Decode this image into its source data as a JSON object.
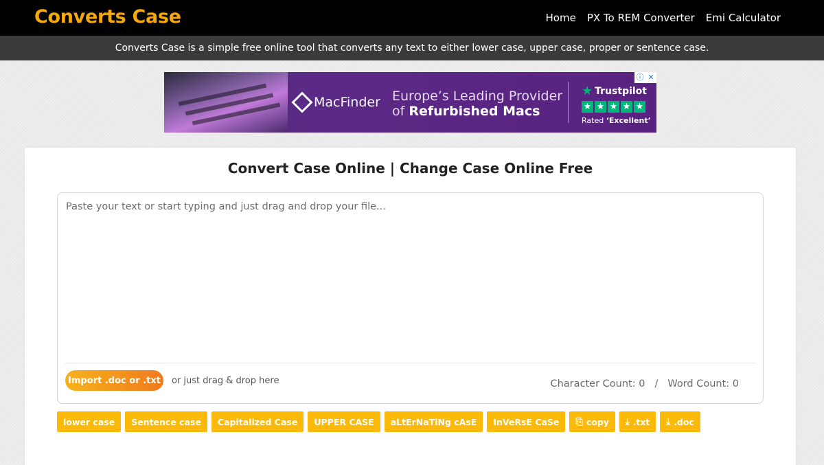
{
  "header": {
    "brand": "Converts Case",
    "nav": [
      "Home",
      "PX To REM Converter",
      "Emi Calculator"
    ]
  },
  "tagline": "Converts Case is a simple free online tool that converts any text to either lower case, upper case, proper or sentence case.",
  "ad": {
    "logo_text": "MacFinder",
    "headline_line1": "Europe’s Leading Provider",
    "headline_prefix": "of",
    "headline_bold": "Refurbished Macs",
    "trustpilot_label": "Trustpilot",
    "rated_prefix": "Rated",
    "rated_value": "‘Excellent’"
  },
  "main": {
    "title": "Convert Case Online | Change Case Online Free",
    "editor_placeholder": "Paste your text or start typing and just drag and drop your file...",
    "import_label": "Import .doc or .txt",
    "drag_hint": "or just drag & drop here",
    "char_count_label": "Character Count: 0",
    "count_separator": "/",
    "word_count_label": "Word Count: 0"
  },
  "toolbar": {
    "lower": "lower case",
    "sentence": "Sentence case",
    "capitalized": "Capitalized Case",
    "upper": "UPPER CASE",
    "alternating": "aLtErNaTiNg cAsE",
    "inverse": "InVeRsE CaSe",
    "copy": "copy",
    "txt": ".txt",
    "doc": ".doc"
  },
  "colors": {
    "brand": "#f5a90f",
    "button": "#fbb90a",
    "header_bg": "#000000",
    "tagline_bg": "#3a3a3a"
  }
}
